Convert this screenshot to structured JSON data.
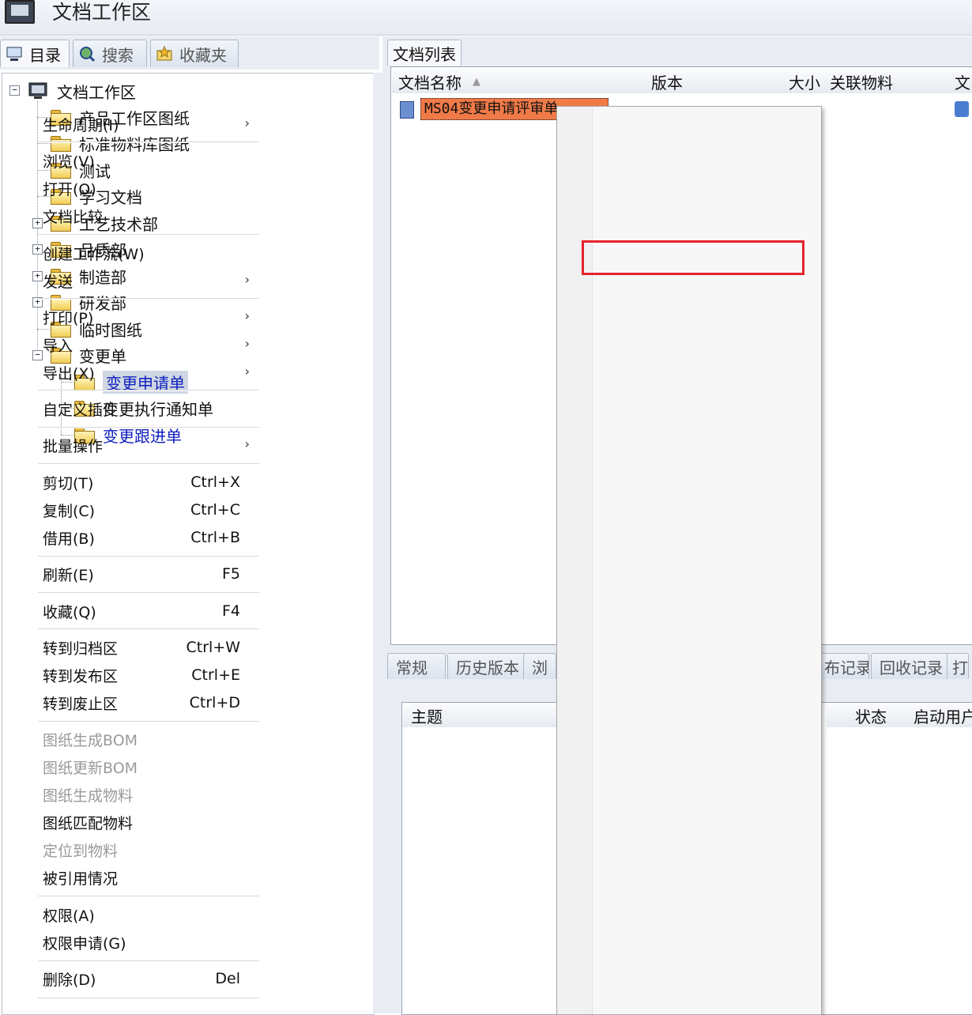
{
  "window": {
    "title": "文档工作区"
  },
  "left_tabs": [
    {
      "label": "目录"
    },
    {
      "label": "搜索"
    },
    {
      "label": "收藏夹"
    }
  ],
  "tree": {
    "root": "文档工作区",
    "items": [
      {
        "label": "产品工作区图纸"
      },
      {
        "label": "标准物料库图纸"
      },
      {
        "label": "测试"
      },
      {
        "label": "学习文档"
      },
      {
        "label": "工艺技术部"
      },
      {
        "label": "品质部"
      },
      {
        "label": "制造部"
      },
      {
        "label": "研发部"
      },
      {
        "label": "临时图纸"
      },
      {
        "label": "变更单"
      }
    ],
    "children": [
      {
        "label": "变更申请单"
      },
      {
        "label": "变更执行通知单"
      },
      {
        "label": "变更跟进单"
      }
    ]
  },
  "doclist": {
    "tab": "文档列表",
    "columns": [
      "文档名称",
      "版本",
      "大小",
      "关联物料",
      "文"
    ],
    "row": {
      "name": "MS04变更申请评审单"
    }
  },
  "bottom_tabs": [
    "常规",
    "历史版本",
    "浏",
    "布记录",
    "回收记录",
    "打印"
  ],
  "bottom_columns": [
    "主题",
    "状态",
    "启动用户"
  ],
  "menu": {
    "items": [
      {
        "label": "生命周期(I)",
        "arrow": "›"
      },
      {
        "label": "浏览(V)"
      },
      {
        "label": "打开(O)"
      },
      {
        "label": "文档比较"
      },
      {
        "label": "创建工作流(W)"
      },
      {
        "label": "发送",
        "arrow": "›"
      },
      {
        "label": "打印(P)",
        "arrow": "›"
      },
      {
        "label": "导入",
        "arrow": "›"
      },
      {
        "label": "导出(X)",
        "arrow": "›"
      },
      {
        "label": "自定义插件"
      },
      {
        "label": "批量操作",
        "arrow": "›"
      },
      {
        "label": "剪切(T)",
        "shortcut": "Ctrl+X"
      },
      {
        "label": "复制(C)",
        "shortcut": "Ctrl+C"
      },
      {
        "label": "借用(B)",
        "shortcut": "Ctrl+B"
      },
      {
        "label": "刷新(E)",
        "shortcut": "F5"
      },
      {
        "label": "收藏(Q)",
        "shortcut": "F4"
      },
      {
        "label": "转到归档区",
        "shortcut": "Ctrl+W"
      },
      {
        "label": "转到发布区",
        "shortcut": "Ctrl+E"
      },
      {
        "label": "转到废止区",
        "shortcut": "Ctrl+D"
      },
      {
        "label": "图纸生成BOM",
        "disabled": true
      },
      {
        "label": "图纸更新BOM",
        "disabled": true
      },
      {
        "label": "图纸生成物料",
        "disabled": true
      },
      {
        "label": "图纸匹配物料"
      },
      {
        "label": "定位到物料",
        "disabled": true
      },
      {
        "label": "被引用情况"
      },
      {
        "label": "权限(A)"
      },
      {
        "label": "权限申请(G)"
      },
      {
        "label": "删除(D)",
        "shortcut": "Del"
      }
    ]
  },
  "colors": {
    "highlight_box": "#e4242c",
    "selected_row": "#f07a48"
  }
}
